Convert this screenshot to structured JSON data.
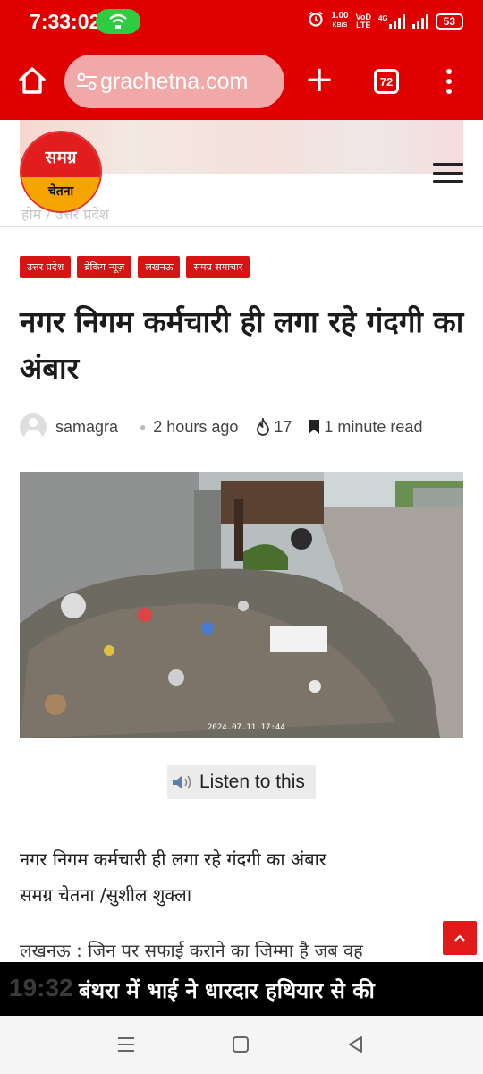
{
  "status_bar": {
    "time": "7:33:02",
    "net_speed_value": "1.00",
    "net_speed_unit": "KB/S",
    "volte_top": "VoD",
    "volte_bottom": "LTE",
    "network": "4G",
    "battery": "53"
  },
  "browser": {
    "url": "grachetna.com",
    "tab_count": "72",
    "accent_color": "#e00000"
  },
  "site": {
    "logo_top": "समग्र",
    "logo_bottom": "चेतना",
    "breadcrumb": "होम / उत्तर प्रदेश"
  },
  "article": {
    "categories": [
      "उत्तर प्रदेश",
      "ब्रेकिंग न्यूज़",
      "लखनऊ",
      "समग्र समाचार"
    ],
    "title": "नगर निगम कर्मचारी ही लगा रहे गंदगी का अंबार",
    "author": "samagra",
    "time_ago": "2 hours ago",
    "views": "17",
    "read_time": "1 minute read",
    "photo_timestamp": "2024.07.11 17:44",
    "listen_label": "Listen to this",
    "body_line1": "नगर निगम कर्मचारी ही लगा रहे गंदगी का अंबार",
    "body_line2": "समग्र चेतना /सुशील शुक्ला",
    "body_line3": "लखनऊ : जिन पर सफाई कराने का जिम्मा है जब वह"
  },
  "ticker": {
    "clock": "19:32",
    "headline": "बंथरा में भाई ने धारदार हथियार से की"
  },
  "icons": {
    "home": "home-icon",
    "site_info": "tune-icon",
    "new_tab": "plus-icon",
    "tabs": "tab-switcher-icon",
    "more": "more-vert-icon",
    "views": "fire-icon",
    "read": "bookmark-icon",
    "listen": "speaker-icon",
    "scroll_top": "chevron-up-icon"
  }
}
